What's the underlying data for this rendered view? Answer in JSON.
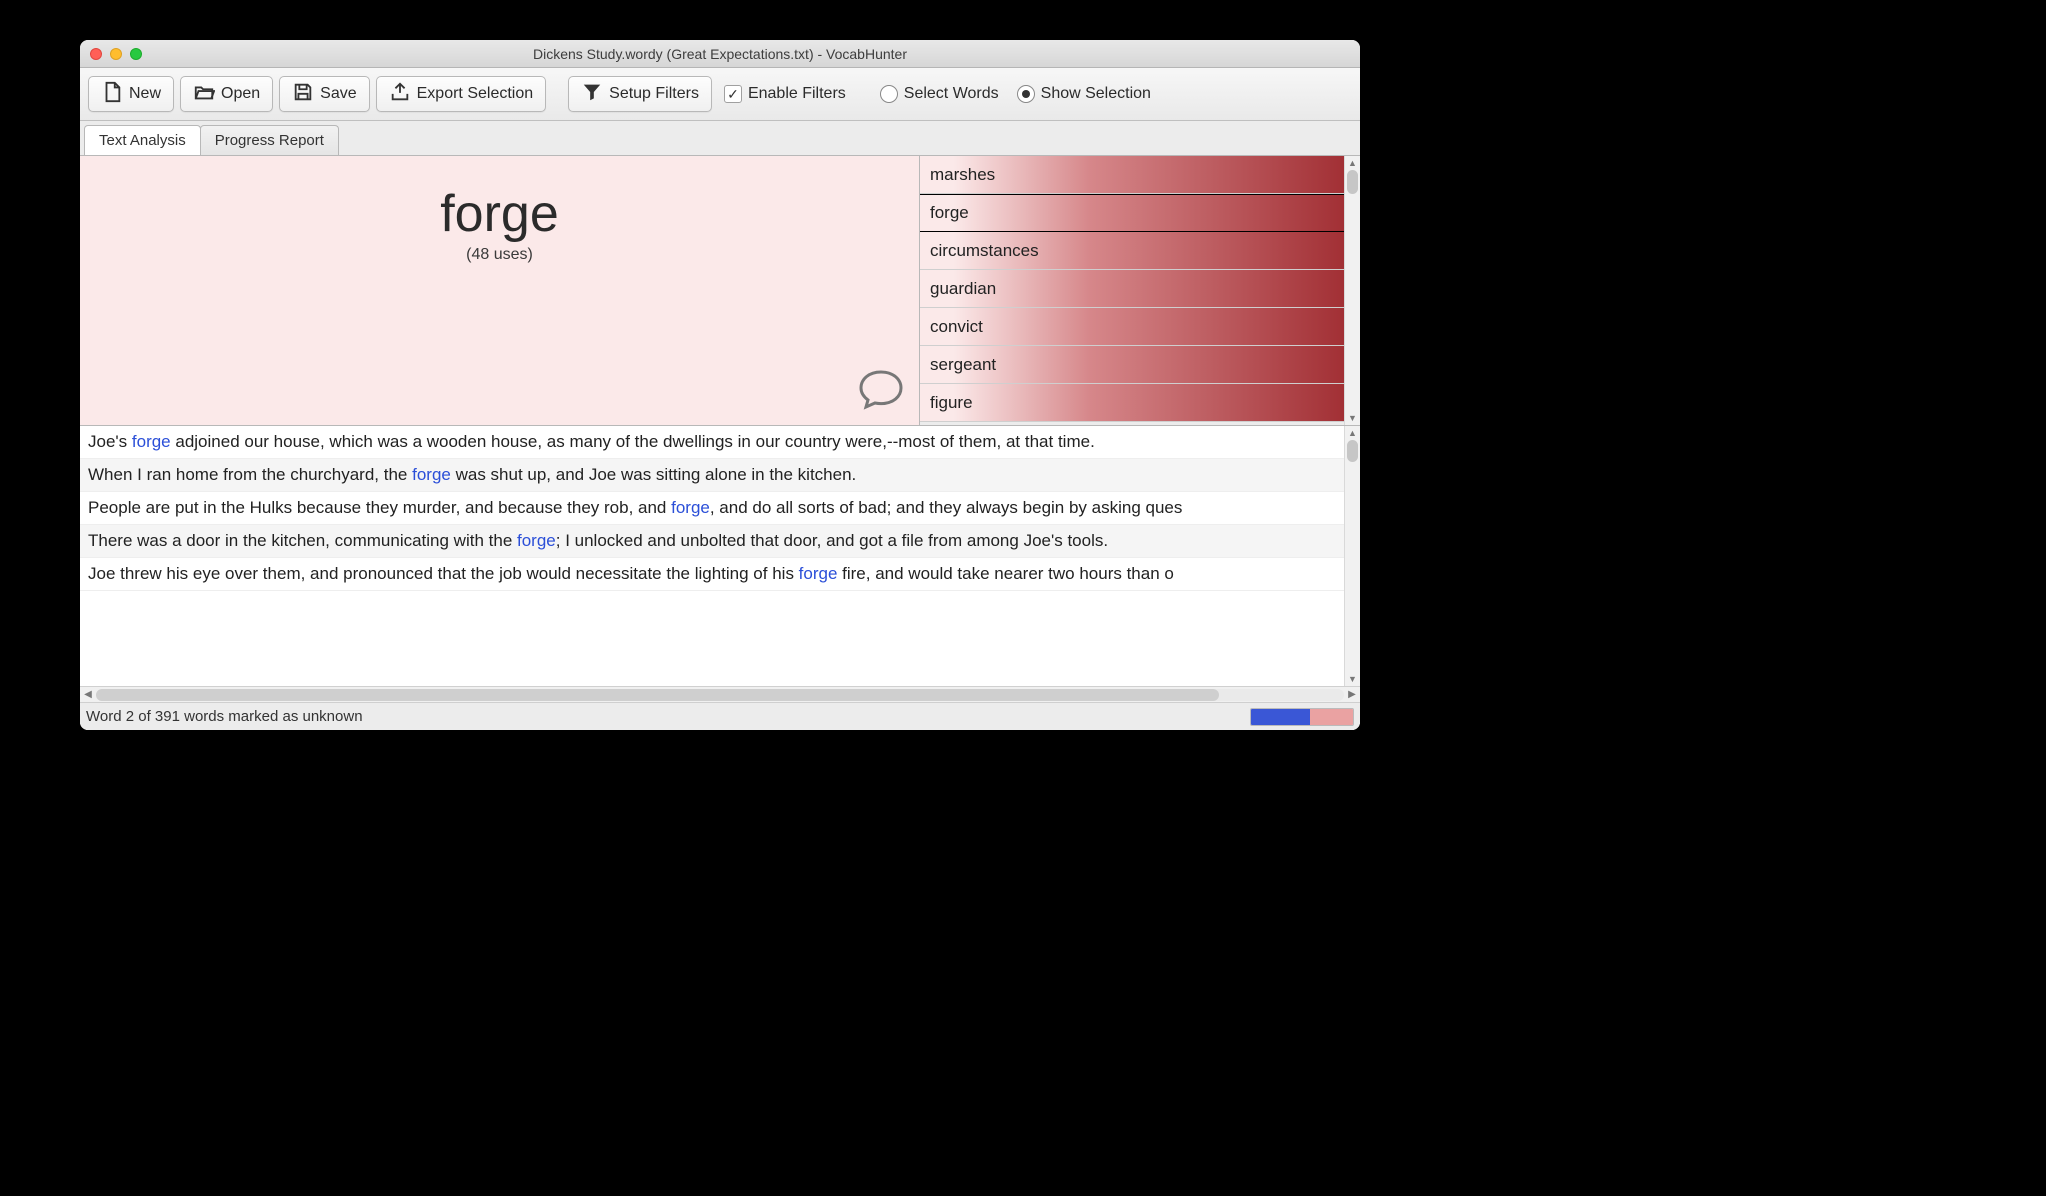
{
  "window": {
    "title": "Dickens Study.wordy (Great Expectations.txt) - VocabHunter"
  },
  "toolbar": {
    "new_label": "New",
    "open_label": "Open",
    "save_label": "Save",
    "export_label": "Export Selection",
    "setup_filters_label": "Setup Filters",
    "enable_filters_label": "Enable Filters",
    "enable_filters_checked": true,
    "select_words_label": "Select Words",
    "show_selection_label": "Show Selection",
    "view_mode": "show_selection"
  },
  "tabs": {
    "text_analysis": "Text Analysis",
    "progress_report": "Progress Report",
    "active": "text_analysis"
  },
  "word": {
    "text": "forge",
    "uses": "(48 uses)"
  },
  "wordlist": [
    "marshes",
    "forge",
    "circumstances",
    "guardian",
    "convict",
    "sergeant",
    "figure"
  ],
  "wordlist_selected_index": 1,
  "sentences": [
    {
      "pre": "Joe's ",
      "hl": "forge",
      "post": " adjoined our house, which was a wooden house, as many of the dwellings in our country were,--most of them, at that time."
    },
    {
      "pre": "When I ran home from the churchyard, the ",
      "hl": "forge",
      "post": " was shut up, and Joe was sitting alone in the kitchen."
    },
    {
      "pre": "People are put in the Hulks because they murder, and because they rob, and ",
      "hl": "forge",
      "post": ", and do all sorts of bad; and they always begin by asking ques"
    },
    {
      "pre": "There was a door in the kitchen, communicating with the ",
      "hl": "forge",
      "post": "; I unlocked and unbolted that door, and got a file from among Joe's tools."
    },
    {
      "pre": "Joe threw his eye over them, and pronounced that the job would necessitate the lighting of his ",
      "hl": "forge",
      "post": " fire, and would take nearer two hours than o"
    }
  ],
  "status": {
    "text": "Word 2 of 391 words marked as unknown",
    "known_pct": 58,
    "unknown_pct": 42
  }
}
